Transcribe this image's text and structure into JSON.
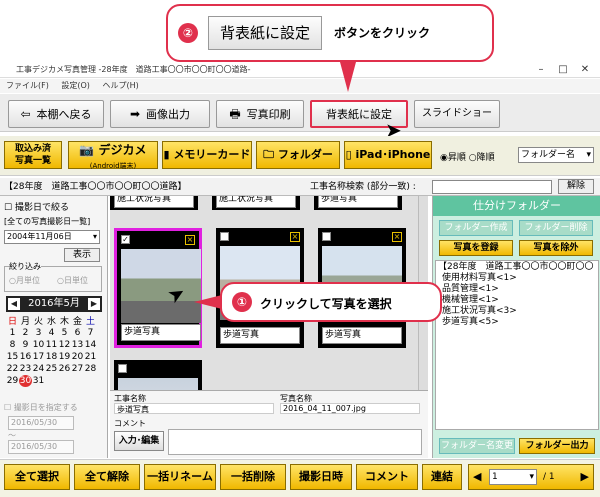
{
  "window": {
    "title": "工事デジカメ写真管理 -28年度　道路工事〇〇市〇〇町〇〇道路-"
  },
  "menu": [
    "ファイル(F)",
    "設定(O)",
    "ヘルプ(H)"
  ],
  "toolbar": {
    "back": "本棚へ戻る",
    "image_output": "画像出力",
    "photo_print": "写真印刷",
    "set_background": "背表紙に設定",
    "slideshow": "スライドショー"
  },
  "source": {
    "captured": "取込み済\n写真一覧",
    "digicam": "デジカメ",
    "digicam_sub": "(Android端末)",
    "memory_card": "メモリーカード",
    "folder": "フォルダー",
    "ipad": "iPad･iPhone",
    "sort_asc": "昇順",
    "sort_desc": "降順",
    "sort_field": "フォルダー名"
  },
  "infobar": {
    "project": "【28年度　道路工事〇〇市〇〇町〇〇道路】",
    "search_label": "工事名称検索 (部分一致) :",
    "search_value": "",
    "clear": "解除"
  },
  "left": {
    "date_filter": "撮影日で絞る",
    "date_list": "[全ての写真撮影日一覧]",
    "date_value": "2004年11月06日",
    "show": "表示",
    "filter_title": "絞り込み",
    "month_unit": "月単位",
    "day_unit": "日単位",
    "calendar_title": "2016年5月",
    "weekdays": [
      "日",
      "月",
      "火",
      "水",
      "木",
      "金",
      "土"
    ],
    "weeks": [
      [
        "1",
        "2",
        "3",
        "4",
        "5",
        "6",
        "7"
      ],
      [
        "8",
        "9",
        "10",
        "11",
        "12",
        "13",
        "14"
      ],
      [
        "15",
        "16",
        "17",
        "18",
        "19",
        "20",
        "21"
      ],
      [
        "22",
        "23",
        "24",
        "25",
        "26",
        "27",
        "28"
      ],
      [
        "29",
        "30",
        "31",
        "",
        "",
        "",
        ""
      ]
    ],
    "period_label": "撮影日を指定する",
    "from_date": "2016/05/30",
    "to_date": "2016/05/30",
    "tilde": "～"
  },
  "photos": [
    {
      "caption": "施工状況写真",
      "checked": false
    },
    {
      "caption": "施工状況写真",
      "checked": false
    },
    {
      "caption": "歩道写真",
      "checked": false
    },
    {
      "caption": "歩道写真",
      "checked": true
    },
    {
      "caption": "歩道写真",
      "checked": false
    },
    {
      "caption": "歩道写真",
      "checked": false
    },
    {
      "caption": "",
      "checked": false
    }
  ],
  "details": {
    "work_name_label": "工事名称",
    "work_name_value": "歩道写真",
    "photo_name_label": "写真名称",
    "photo_name_value": "2016_04_11_007.jpg",
    "comment_label": "コメント",
    "edit_button": "入力･編集"
  },
  "right": {
    "title": "仕分けフォルダー",
    "create_folder": "フォルダー作成",
    "delete_folder": "フォルダー削除",
    "register_photo": "写真を登録",
    "exclude_photo": "写真を除外",
    "tree": [
      "【28年度　道路工事〇〇市〇〇町〇〇",
      "使用材料写真<1>",
      "品質管理<1>",
      "機械管理<1>",
      "施工状況写真<3>",
      "歩道写真<5>"
    ],
    "rename_folder": "フォルダー名変更",
    "folder_output": "フォルダー出力"
  },
  "bottom": {
    "select_all": "全て選択",
    "deselect_all": "全て解除",
    "batch_rename": "一括リネーム",
    "batch_delete": "一括削除",
    "shot_datetime": "撮影日時",
    "comment": "コメント",
    "concat": "連結",
    "page": "1",
    "total": "/ 1"
  },
  "annotations": {
    "step2_num": "②",
    "step2_button": "背表紙に設定",
    "step2_text": "ボタンをクリック",
    "step1_num": "①",
    "step1_text": "クリックして写真を選択"
  },
  "colors": {
    "accent_red": "#e0304c",
    "brand_yellow": "#f0b800",
    "folder_teal": "#5fc4a0",
    "selection_magenta": "#e020e0"
  }
}
